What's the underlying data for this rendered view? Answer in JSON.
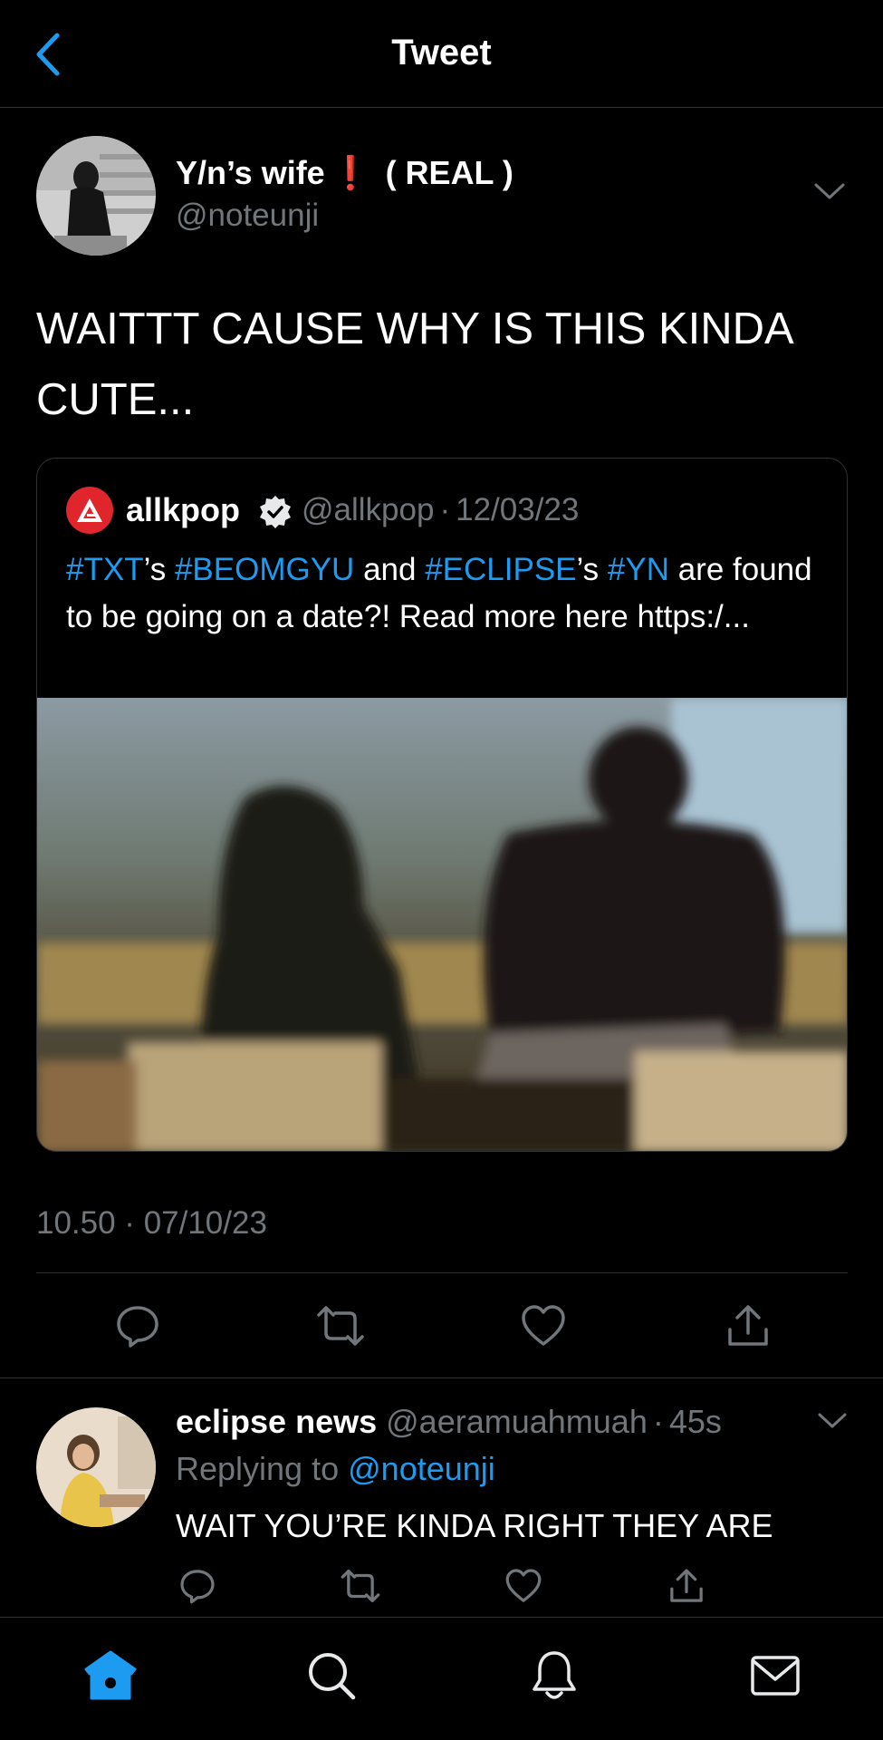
{
  "header": {
    "title": "Tweet"
  },
  "tweet": {
    "author_name": "Y/n’s wife",
    "author_badge": "❗",
    "author_suffix": "( REAL )",
    "author_handle": "@noteunji",
    "text": "WAITTT CAUSE WHY IS THIS KINDA CUTE...",
    "timestamp": "10.50 · 07/10/23"
  },
  "quote": {
    "name": "allkpop",
    "handle": "@allkpop",
    "sep": "·",
    "date": "12/03/23",
    "text_parts": {
      "t1": "#TXT",
      "t2": "’s ",
      "t3": "#BEOMGYU",
      "t4": " and ",
      "t5": "#ECLIPSE",
      "t6": "’s ",
      "t7": "#YN",
      "t8": " are found to be going on a date?! Read more here https:/..."
    }
  },
  "reply": {
    "name": "eclipse news",
    "handle": "@aeramuahmuah",
    "sep": "·",
    "time": "45s",
    "replying_label": "Replying to",
    "replying_mention": "@noteunji",
    "text": "WAIT YOU’RE KINDA RIGHT THEY ARE"
  },
  "icons": {
    "back": "chevron-left-icon",
    "more": "chevron-down-icon",
    "reply": "speech-bubble-icon",
    "retweet": "retweet-icon",
    "like": "heart-icon",
    "share": "share-icon",
    "home": "home-icon",
    "search": "search-icon",
    "notifications": "bell-icon",
    "messages": "mail-icon"
  },
  "colors": {
    "accent": "#1d9bf0",
    "background": "#000000",
    "muted": "#71767b",
    "badge": "#e0245e",
    "allkpop_red": "#e0262c"
  }
}
